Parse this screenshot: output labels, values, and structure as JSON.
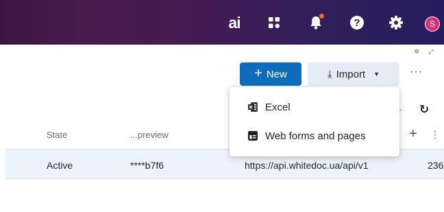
{
  "topbar": {
    "logo_text": "ai",
    "avatar_initial": "S",
    "icons": [
      "apps-icon",
      "bell-icon",
      "help-icon",
      "gear-icon"
    ],
    "notification_dot_color": "#f06a3a",
    "avatar_color": "#d7317a"
  },
  "toolbar": {
    "new_label": "New",
    "import_label": "Import",
    "more_label": "···",
    "accent_color": "#0f6cbd"
  },
  "import_menu": {
    "items": [
      {
        "label": "Excel",
        "icon": "excel-icon"
      },
      {
        "label": "Web forms and pages",
        "icon": "web-form-icon"
      }
    ]
  },
  "table": {
    "columns": [
      "State",
      "...preview"
    ],
    "rows": [
      {
        "state": "Active",
        "preview": "****b7f6",
        "url": "https://api.whitedoc.ua/api/v1",
        "count": "236"
      }
    ]
  }
}
